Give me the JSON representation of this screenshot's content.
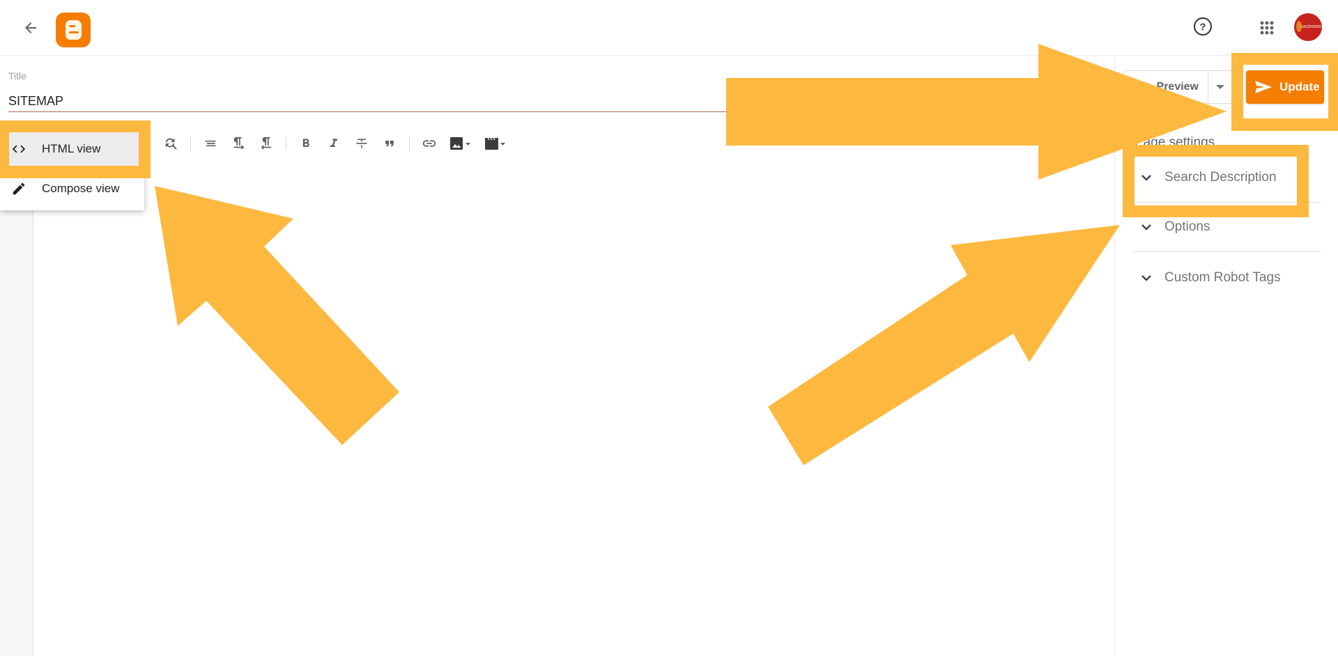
{
  "header": {
    "back_icon": "arrow-left-icon",
    "logo": "blogger-logo",
    "help_icon": "help-circle-icon",
    "apps_icon": "apps-grid-icon",
    "avatar_text": "BAZZHOOD"
  },
  "title_field": {
    "label": "Title",
    "value": "SITEMAP"
  },
  "mode_menu": {
    "items": [
      {
        "label": "HTML view",
        "icon": "code-brackets-icon",
        "selected": true
      },
      {
        "label": "Compose view",
        "icon": "pencil-icon",
        "selected": false
      }
    ]
  },
  "toolbar": {
    "buttons": [
      {
        "name": "find-replace",
        "icon": "find-replace-icon"
      },
      {
        "name": "align",
        "icon": "align-icon"
      },
      {
        "name": "ltr",
        "icon": "paragraph-ltr-icon"
      },
      {
        "name": "rtl",
        "icon": "paragraph-rtl-icon"
      },
      {
        "name": "bold",
        "icon": "bold-icon"
      },
      {
        "name": "italic",
        "icon": "italic-icon"
      },
      {
        "name": "strikethrough",
        "icon": "strikethrough-icon"
      },
      {
        "name": "quote",
        "icon": "quote-icon"
      },
      {
        "name": "link",
        "icon": "link-icon"
      },
      {
        "name": "insert-image",
        "icon": "image-icon"
      },
      {
        "name": "insert-video",
        "icon": "video-icon"
      }
    ]
  },
  "actions": {
    "preview_label": "Preview",
    "update_label": "Update"
  },
  "settings": {
    "section_label": "Page settings",
    "items": [
      {
        "label": "Search Description"
      },
      {
        "label": "Options"
      },
      {
        "label": "Custom Robot Tags"
      }
    ]
  },
  "colors": {
    "brand_orange": "#f57d00",
    "annotation_yellow": "#fdb93f",
    "title_underline": "#b0684a"
  }
}
